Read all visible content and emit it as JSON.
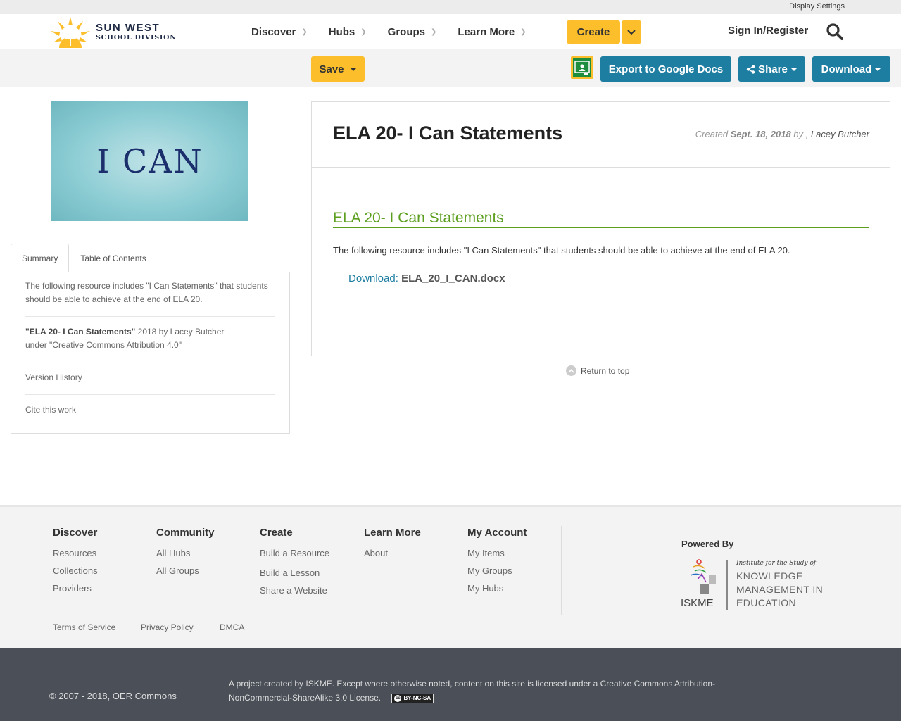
{
  "topbar": {
    "display_settings": "Display Settings"
  },
  "brand": {
    "line1": "SUN WEST",
    "line2": "SCHOOL DIVISION",
    "color": "#fcbf2b"
  },
  "nav": {
    "items": [
      {
        "label": "Discover"
      },
      {
        "label": "Hubs"
      },
      {
        "label": "Groups"
      },
      {
        "label": "Learn More"
      }
    ],
    "create": "Create",
    "signin": "Sign In/Register"
  },
  "toolbar": {
    "save": "Save",
    "export": "Export to Google Docs",
    "share": "Share",
    "download": "Download",
    "accent": "#fcbf2b",
    "button_blue": "#1e7ea1"
  },
  "thumbnail": {
    "text": "I CAN"
  },
  "sidebar": {
    "tabs": [
      {
        "label": "Summary",
        "active": true
      },
      {
        "label": "Table of Contents",
        "active": false
      }
    ],
    "summary": "The following resource includes \"I Can Statements\" that students should be able to achieve at the end of ELA 20.",
    "attribution_title": "\"ELA 20- I Can Statements\"",
    "attribution_rest": " 2018 by Lacey Butcher",
    "attribution_license": "under \"Creative Commons Attribution 4.0\"",
    "version_history": "Version History",
    "cite": "Cite this work"
  },
  "resource": {
    "title": "ELA 20- I Can Statements",
    "created_prefix": "Created",
    "created_date": "Sept. 18, 2018",
    "by": "by ,",
    "author": "Lacey Butcher",
    "section_title": "ELA 20- I Can Statements",
    "description": "The following resource includes \"I Can Statements\" that students should be able to achieve at the end of ELA 20.",
    "download_label": "Download:",
    "download_file": "ELA_20_I_CAN.docx",
    "section_color": "#5c9e1d"
  },
  "return_to_top": "Return to top",
  "footer": {
    "columns": [
      {
        "heading": "Discover",
        "items": [
          "Resources",
          "Collections",
          "Providers"
        ]
      },
      {
        "heading": "Community",
        "items": [
          "All Hubs",
          "All Groups"
        ]
      },
      {
        "heading": "Create",
        "items": [
          "Build a Resource",
          "Build a Lesson",
          "Share a Website"
        ]
      },
      {
        "heading": "Learn More",
        "items": [
          "About"
        ]
      },
      {
        "heading": "My Account",
        "items": [
          "My Items",
          "My Groups",
          "My Hubs"
        ]
      }
    ],
    "legal": [
      "Terms of Service",
      "Privacy Policy",
      "DMCA"
    ],
    "powered_by": "Powered By",
    "iskme": {
      "word": "ISKME",
      "institute": "Institute for the Study of",
      "line1": "KNOWLEDGE",
      "line2": "MANAGEMENT IN",
      "line3": "EDUCATION"
    }
  },
  "bottom": {
    "copyright": "© 2007 - 2018, OER Commons",
    "license_text": "A project created by ISKME. Except where otherwise noted, content on this site is licensed under a Creative Commons Attribution-NonCommercial-ShareAlike 3.0 License.",
    "badge": "BY-NC-SA"
  }
}
